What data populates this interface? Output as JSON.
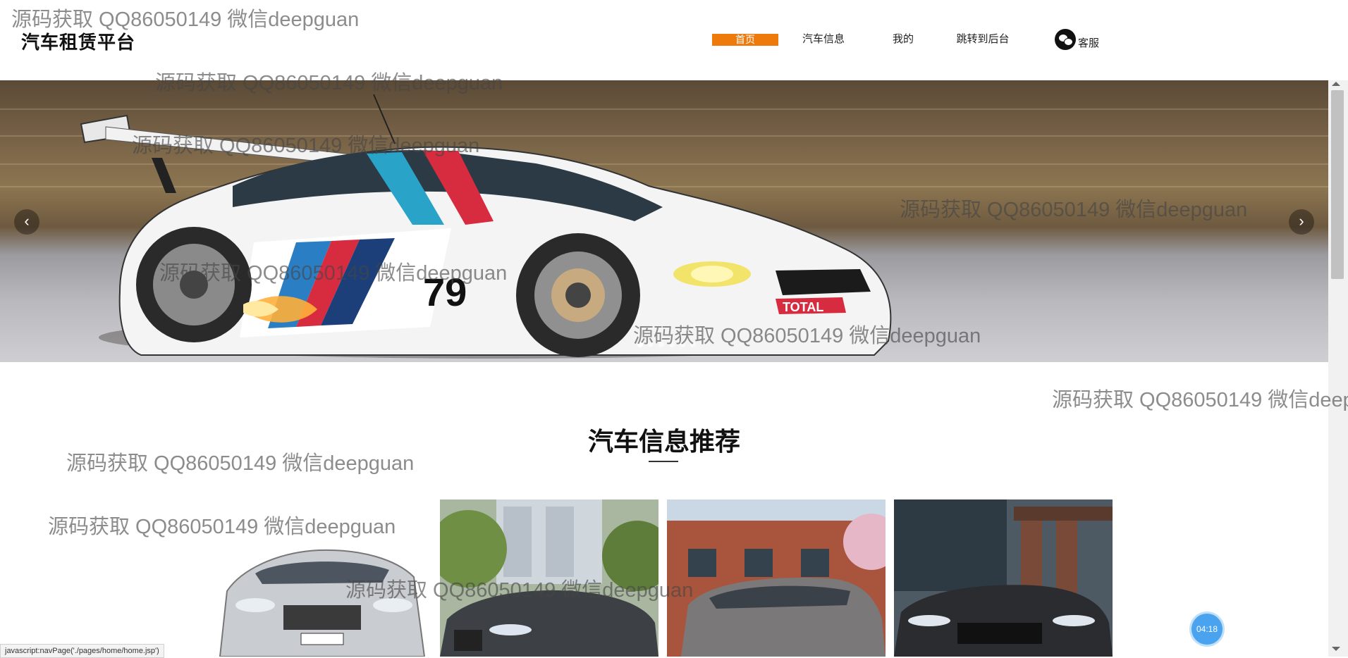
{
  "brand": "汽车租赁平台",
  "nav": {
    "home": "首页",
    "cars": "汽车信息",
    "mine": "我的",
    "admin": "跳转到后台",
    "service": "客服"
  },
  "carousel": {
    "prev": "‹",
    "next": "›",
    "slides": 6,
    "active_index": 0
  },
  "section": {
    "title": "汽车信息推荐"
  },
  "status_url": "javascript:navPage('./pages/home/home.jsp')",
  "timer": "04:18",
  "watermark": "源码获取 QQ86050149 微信deepguan",
  "colors": {
    "accent": "#ee7a0c",
    "timer": "#4aa3ee"
  }
}
